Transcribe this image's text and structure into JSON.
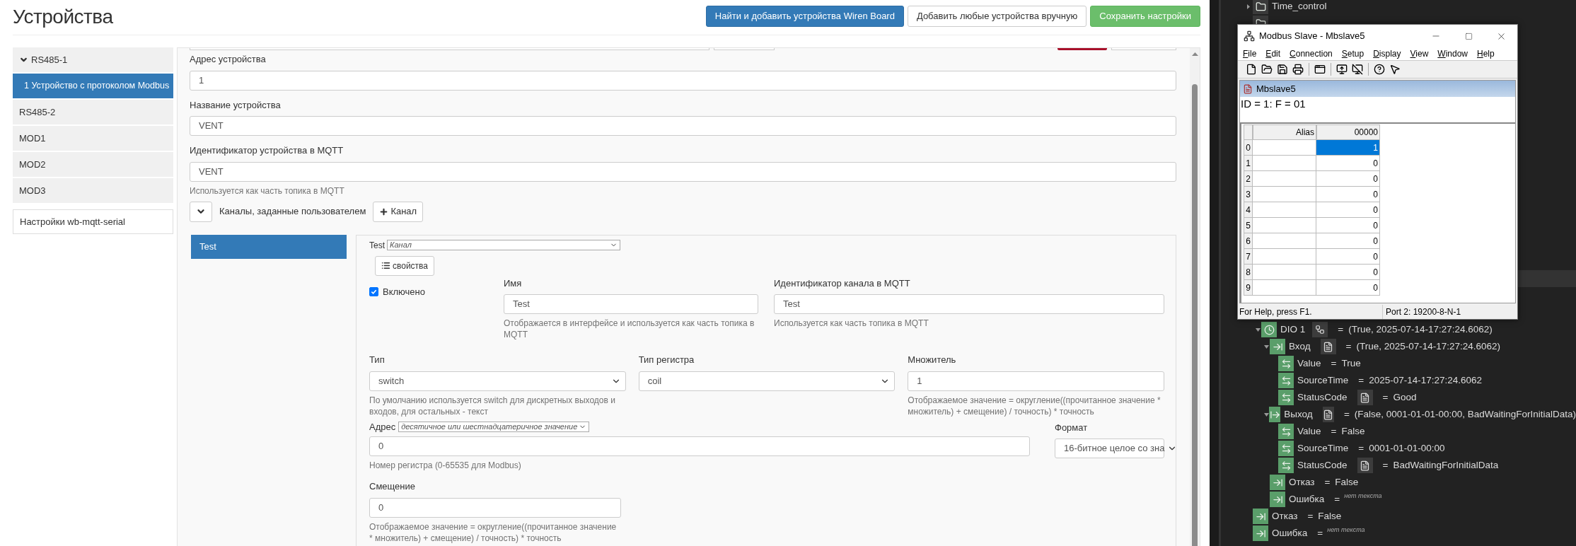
{
  "page": {
    "title": "Устройства",
    "buttons": [
      {
        "label": "Найти и добавить устройства Wiren Board",
        "kind": "primary"
      },
      {
        "label": "Добавить любые устройства вручную",
        "kind": "default"
      },
      {
        "label": "Сохранить настройки",
        "kind": "success"
      }
    ]
  },
  "sidebar": {
    "items": [
      {
        "label": "RS485-1",
        "kind": "port",
        "expanded": true,
        "selected": false
      },
      {
        "label": "1 Устройство с протоколом Modbus",
        "kind": "device",
        "selected": true
      },
      {
        "label": "RS485-2",
        "kind": "port",
        "expanded": false,
        "selected": false
      },
      {
        "label": "MOD1",
        "kind": "port",
        "expanded": false,
        "selected": false
      },
      {
        "label": "MOD2",
        "kind": "port",
        "expanded": false,
        "selected": false
      },
      {
        "label": "MOD3",
        "kind": "port",
        "expanded": false,
        "selected": false
      },
      {
        "label": "Настройки wb-mqtt-serial",
        "kind": "settings",
        "selected": false
      }
    ]
  },
  "device_form": {
    "fields": [
      {
        "label": "Адрес устройства",
        "value": "1"
      },
      {
        "label": "Название устройства",
        "value": "VENT"
      },
      {
        "label": "Идентификатор устройства в MQTT",
        "value": "VENT",
        "help": "Используется как часть топика в MQTT"
      }
    ],
    "channels": {
      "expanded": true,
      "label": "Каналы, заданные пользователем",
      "add_button": "Канал"
    }
  },
  "channel_tabs": [
    {
      "label": "Test",
      "selected": true
    }
  ],
  "channel": {
    "name": "Test",
    "type": "Канал",
    "properties_button": "свойства",
    "enabled": {
      "label": "Включено",
      "checked": true
    },
    "name_field": {
      "label": "Имя",
      "value": "Test",
      "help": "Отображается в интерфейсе и используется как часть топика в MQTT"
    },
    "mqtt_field": {
      "label": "Идентификатор канала в MQTT",
      "value": "Test",
      "help": "Используется как часть топика в MQTT"
    },
    "row_fields": [
      {
        "label": "Тип",
        "kind": "select",
        "value": "switch",
        "help": "По умолчанию используется switch для дискретных выходов и входов, для остальных - текст"
      },
      {
        "label": "Тип регистра",
        "kind": "select",
        "value": "coil"
      },
      {
        "label": "Множитель",
        "kind": "input",
        "value": "1",
        "help": "Отображаемое значение = округление((прочитанное значение * множитель) + смещение) / точность) * точность"
      }
    ],
    "address": {
      "label": "Адрес",
      "mode": "десятичное или шестнадцатеричное значение",
      "value": "0",
      "help": "Номер регистра (0-65535 для Modbus)"
    },
    "format": {
      "label": "Формат",
      "value": "16-битное целое со зна"
    },
    "offset": {
      "label": "Смещение",
      "value": "0",
      "help": "Отображаемое значение = округление((прочитанное значение * множитель) + смещение) / точность) * точность"
    }
  },
  "modbus_window": {
    "title": "Modbus Slave - Mbslave5",
    "menu": [
      "File",
      "Edit",
      "Connection",
      "Setup",
      "Display",
      "View",
      "Window",
      "Help"
    ],
    "child_title": "Mbslave5",
    "header": "ID = 1: F = 01",
    "columns": [
      "Alias",
      "00000"
    ],
    "rows": [
      {
        "index": "0",
        "value": "1",
        "selected": true
      },
      {
        "index": "1",
        "value": "0",
        "selected": false
      },
      {
        "index": "2",
        "value": "0",
        "selected": false
      },
      {
        "index": "3",
        "value": "0",
        "selected": false
      },
      {
        "index": "4",
        "value": "0",
        "selected": false
      },
      {
        "index": "5",
        "value": "0",
        "selected": false
      },
      {
        "index": "6",
        "value": "0",
        "selected": false
      },
      {
        "index": "7",
        "value": "0",
        "selected": false
      },
      {
        "index": "8",
        "value": "0",
        "selected": false
      },
      {
        "index": "9",
        "value": "0",
        "selected": false
      }
    ],
    "status_bar": [
      "For Help, press F1.",
      "Port 2: 19200-8-N-1"
    ]
  },
  "tree": {
    "upper_items": [
      {
        "name": "Time_control",
        "kind": "folder",
        "expanded": false
      },
      {
        "kind": "folder"
      }
    ],
    "lower_nested_items": [
      {
        "name": "DIO 1",
        "kind": "timer",
        "sign": "=",
        "value": "(True, 2025-07-14-17:27:24.6062)",
        "expanded": true,
        "children": [
          {
            "name": "Вход",
            "kind": "input_group",
            "sign": "=",
            "value": "(True, 2025-07-14-17:27:24.6062)",
            "expanded": true,
            "children": [
              {
                "name": "Value",
                "kind": "variable",
                "sign": "=",
                "value": "True"
              },
              {
                "name": "SourceTime",
                "kind": "variable",
                "sign": "=",
                "value": "2025-07-14-17:27:24.6062"
              },
              {
                "name": "StatusCode",
                "kind": "status",
                "sign": "=",
                "value": "Good"
              }
            ]
          },
          {
            "name": "Выход",
            "kind": "output_group",
            "sign": "=",
            "value": "(False, 0001-01-01-00:00, BadWaitingForInitialData)",
            "expanded": true,
            "children": [
              {
                "name": "Value",
                "kind": "variable",
                "sign": "=",
                "value": "False"
              },
              {
                "name": "SourceTime",
                "kind": "variable",
                "sign": "=",
                "value": "0001-01-01-00:00"
              },
              {
                "name": "StatusCode",
                "kind": "status",
                "sign": "=",
                "value": "BadWaitingForInitialData"
              }
            ]
          },
          {
            "name": "Отказ",
            "kind": "signal",
            "sign": "=",
            "value": "False"
          },
          {
            "name": "Ошибка",
            "kind": "signal",
            "sign": "=",
            "value": "нет текста",
            "empty": true
          }
        ]
      }
    ],
    "lower_items": [
      {
        "name": "Отказ",
        "kind": "signal",
        "sign": "=",
        "value": "False"
      },
      {
        "name": "Ошибка",
        "kind": "signal",
        "sign": "=",
        "value": "нет текста",
        "empty": true
      }
    ]
  }
}
